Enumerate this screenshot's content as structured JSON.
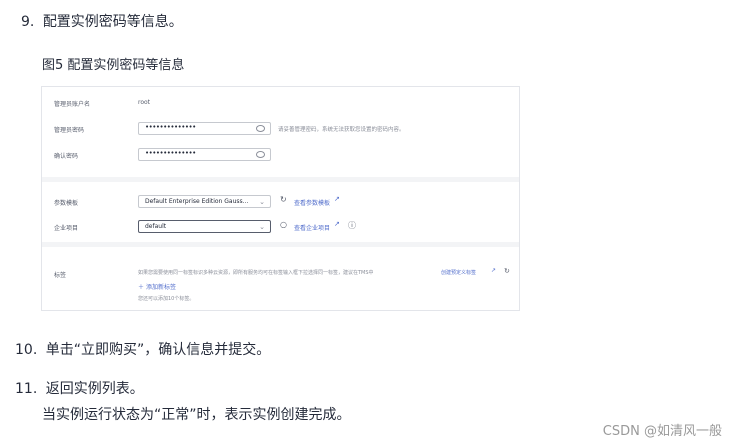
{
  "steps": [
    {
      "number": "9.",
      "text": "配置实例密码等信息。"
    },
    {
      "number": "10.",
      "text": "单击“立即购买”，确认信息并提交。"
    },
    {
      "number": "11.",
      "text": "返回实例列表。"
    }
  ],
  "step11_detail": "当实例运行状态为“正常”时，表示实例创建完成。",
  "figure_caption": "图5 配置实例密码等信息",
  "form": {
    "admin_account_label": "管理员账户名",
    "admin_account_value": "root",
    "admin_password_label": "管理员密码",
    "admin_password_value": "••••••••••••••",
    "admin_password_hint": "请妥善管理密码，系统无法获取您设置的密码内容。",
    "confirm_password_label": "确认密码",
    "confirm_password_value": "••••••••••••••",
    "param_template_label": "参数模板",
    "param_template_value": "Default Enterprise Edition Gauss...",
    "param_template_link": "查看参数模板",
    "enterprise_project_label": "企业项目",
    "enterprise_project_value": "default",
    "enterprise_project_link": "查看企业项目",
    "tags_label": "标签",
    "tags_hint": "如果您需要使用同一标签标识多种云资源，即所有服务均可在标签输入框下拉选择同一标签，建议在TMS中",
    "tags_hint_link": "创建预定义标签",
    "add_tag_label": "添加新标签",
    "tags_remaining": "您还可以添加10个标签。"
  },
  "watermark": "CSDN @如清风一般",
  "colors": {
    "link": "#526ecc",
    "text": "#252b3a",
    "muted": "#8a8e99"
  }
}
